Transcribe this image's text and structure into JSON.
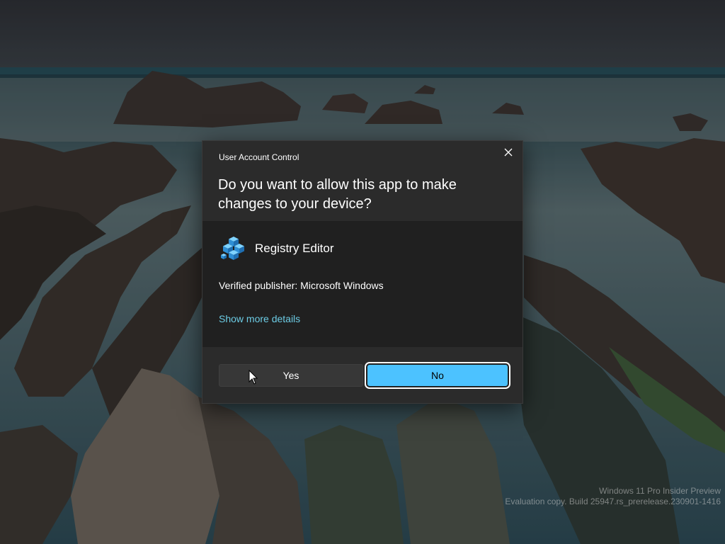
{
  "desktop": {
    "wallpaper": "rocky coastline at dusk",
    "watermark_line1": "Windows 11 Pro Insider Preview",
    "watermark_line2": "Evaluation copy. Build 25947.rs_prerelease.230901-1416"
  },
  "dialog": {
    "title": "User Account Control",
    "close_icon": "close-icon",
    "question": "Do you want to allow this app to make changes to your device?",
    "app": {
      "icon": "registry-editor-icon",
      "name": "Registry Editor"
    },
    "publisher": "Verified publisher: Microsoft Windows",
    "details_link": "Show more details",
    "buttons": {
      "yes": "Yes",
      "no": "No"
    }
  },
  "colors": {
    "accent": "#4cc2ff",
    "link": "#6ccbe4",
    "dialog_bg": "#202020",
    "header_bg": "#2b2b2b"
  }
}
